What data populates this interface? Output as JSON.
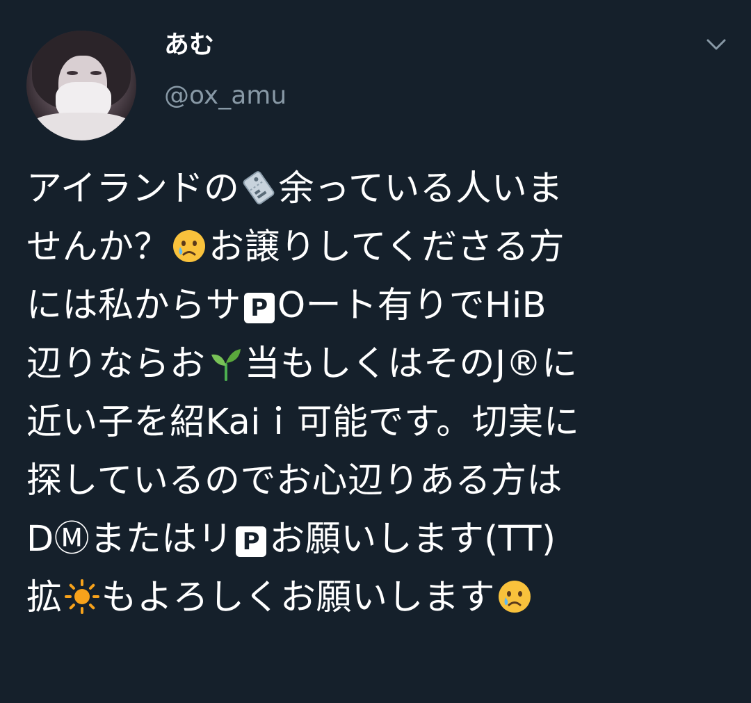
{
  "tweet": {
    "display_name": "あむ",
    "handle": "@ox_amu",
    "icons": {
      "menu": "chevron-down-icon",
      "ticket": "ticket-icon",
      "crying": "crying-face-icon",
      "parking": "p-button-icon",
      "seedling": "seedling-icon",
      "sun": "sun-icon"
    },
    "colors": {
      "background": "#15202b",
      "text": "#ffffff",
      "secondary": "#8899a6"
    },
    "body": {
      "l1a": "アイランドの",
      "l1b": "余っている人いま",
      "l2a": "せんか？",
      "l2b": "お譲りしてくださる方",
      "l3a": "には私からサ",
      "p": "P",
      "l3b": "Oート有りでHiB",
      "l4a": "辺りならお",
      "l4b": "当もしくはそのJ®に",
      "l5": "近い子を紹Kaiｉ可能です。切実に",
      "l6": "探しているのでお心辺りある方は",
      "l7a": "DⓂまたはリ",
      "l7b": "お願いします(TT)",
      "l8a": "拡",
      "l8b": "もよろしくお願いします"
    }
  }
}
